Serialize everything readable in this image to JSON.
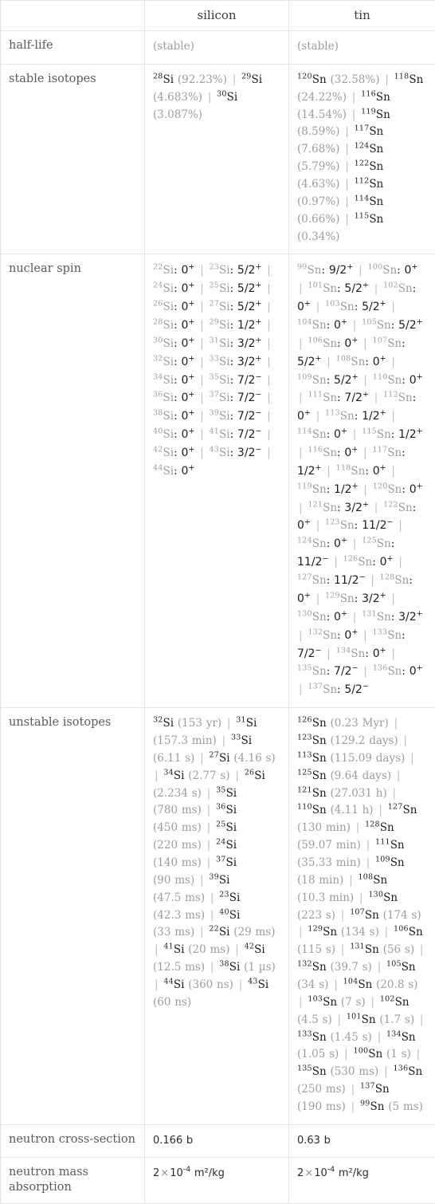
{
  "table": {
    "columns": [
      "",
      "silicon",
      "tin"
    ],
    "rows": [
      {
        "label": "half-life",
        "type": "muted-text",
        "silicon": "(stable)",
        "tin": "(stable)"
      },
      {
        "label": "stable isotopes",
        "type": "isotope-abundance",
        "silicon": [
          {
            "mass": "28",
            "symbol": "Si",
            "value": "(92.23%)"
          },
          {
            "mass": "29",
            "symbol": "Si",
            "value": "(4.683%)"
          },
          {
            "mass": "30",
            "symbol": "Si",
            "value": "(3.087%)"
          }
        ],
        "tin": [
          {
            "mass": "120",
            "symbol": "Sn",
            "value": "(32.58%)"
          },
          {
            "mass": "118",
            "symbol": "Sn",
            "value": "(24.22%)"
          },
          {
            "mass": "116",
            "symbol": "Sn",
            "value": "(14.54%)"
          },
          {
            "mass": "119",
            "symbol": "Sn",
            "value": "(8.59%)"
          },
          {
            "mass": "117",
            "symbol": "Sn",
            "value": "(7.68%)"
          },
          {
            "mass": "124",
            "symbol": "Sn",
            "value": "(5.79%)"
          },
          {
            "mass": "122",
            "symbol": "Sn",
            "value": "(4.63%)"
          },
          {
            "mass": "112",
            "symbol": "Sn",
            "value": "(0.97%)"
          },
          {
            "mass": "114",
            "symbol": "Sn",
            "value": "(0.66%)"
          },
          {
            "mass": "115",
            "symbol": "Sn",
            "value": "(0.34%)"
          }
        ]
      },
      {
        "label": "nuclear spin",
        "type": "nuclear-spin",
        "silicon": [
          {
            "mass": "22",
            "symbol": "Si",
            "spin": "0",
            "sup": "+"
          },
          {
            "mass": "23",
            "symbol": "Si",
            "spin": "5/2",
            "sup": "+"
          },
          {
            "mass": "24",
            "symbol": "Si",
            "spin": "0",
            "sup": "+"
          },
          {
            "mass": "25",
            "symbol": "Si",
            "spin": "5/2",
            "sup": "+"
          },
          {
            "mass": "26",
            "symbol": "Si",
            "spin": "0",
            "sup": "+"
          },
          {
            "mass": "27",
            "symbol": "Si",
            "spin": "5/2",
            "sup": "+"
          },
          {
            "mass": "28",
            "symbol": "Si",
            "spin": "0",
            "sup": "+"
          },
          {
            "mass": "29",
            "symbol": "Si",
            "spin": "1/2",
            "sup": "+"
          },
          {
            "mass": "30",
            "symbol": "Si",
            "spin": "0",
            "sup": "+"
          },
          {
            "mass": "31",
            "symbol": "Si",
            "spin": "3/2",
            "sup": "+"
          },
          {
            "mass": "32",
            "symbol": "Si",
            "spin": "0",
            "sup": "+"
          },
          {
            "mass": "33",
            "symbol": "Si",
            "spin": "3/2",
            "sup": "+"
          },
          {
            "mass": "34",
            "symbol": "Si",
            "spin": "0",
            "sup": "+"
          },
          {
            "mass": "35",
            "symbol": "Si",
            "spin": "7/2",
            "sup": "−"
          },
          {
            "mass": "36",
            "symbol": "Si",
            "spin": "0",
            "sup": "+"
          },
          {
            "mass": "37",
            "symbol": "Si",
            "spin": "7/2",
            "sup": "−"
          },
          {
            "mass": "38",
            "symbol": "Si",
            "spin": "0",
            "sup": "+"
          },
          {
            "mass": "39",
            "symbol": "Si",
            "spin": "7/2",
            "sup": "−"
          },
          {
            "mass": "40",
            "symbol": "Si",
            "spin": "0",
            "sup": "+"
          },
          {
            "mass": "41",
            "symbol": "Si",
            "spin": "7/2",
            "sup": "−"
          },
          {
            "mass": "42",
            "symbol": "Si",
            "spin": "0",
            "sup": "+"
          },
          {
            "mass": "43",
            "symbol": "Si",
            "spin": "3/2",
            "sup": "−"
          },
          {
            "mass": "44",
            "symbol": "Si",
            "spin": "0",
            "sup": "+"
          }
        ],
        "tin": [
          {
            "mass": "99",
            "symbol": "Sn",
            "spin": "9/2",
            "sup": "+"
          },
          {
            "mass": "100",
            "symbol": "Sn",
            "spin": "0",
            "sup": "+"
          },
          {
            "mass": "101",
            "symbol": "Sn",
            "spin": "5/2",
            "sup": "+"
          },
          {
            "mass": "102",
            "symbol": "Sn",
            "spin": "0",
            "sup": "+"
          },
          {
            "mass": "103",
            "symbol": "Sn",
            "spin": "5/2",
            "sup": "+"
          },
          {
            "mass": "104",
            "symbol": "Sn",
            "spin": "0",
            "sup": "+"
          },
          {
            "mass": "105",
            "symbol": "Sn",
            "spin": "5/2",
            "sup": "+"
          },
          {
            "mass": "106",
            "symbol": "Sn",
            "spin": "0",
            "sup": "+"
          },
          {
            "mass": "107",
            "symbol": "Sn",
            "spin": "5/2",
            "sup": "+"
          },
          {
            "mass": "108",
            "symbol": "Sn",
            "spin": "0",
            "sup": "+"
          },
          {
            "mass": "109",
            "symbol": "Sn",
            "spin": "5/2",
            "sup": "+"
          },
          {
            "mass": "110",
            "symbol": "Sn",
            "spin": "0",
            "sup": "+"
          },
          {
            "mass": "111",
            "symbol": "Sn",
            "spin": "7/2",
            "sup": "+"
          },
          {
            "mass": "112",
            "symbol": "Sn",
            "spin": "0",
            "sup": "+"
          },
          {
            "mass": "113",
            "symbol": "Sn",
            "spin": "1/2",
            "sup": "+"
          },
          {
            "mass": "114",
            "symbol": "Sn",
            "spin": "0",
            "sup": "+"
          },
          {
            "mass": "115",
            "symbol": "Sn",
            "spin": "1/2",
            "sup": "+"
          },
          {
            "mass": "116",
            "symbol": "Sn",
            "spin": "0",
            "sup": "+"
          },
          {
            "mass": "117",
            "symbol": "Sn",
            "spin": "1/2",
            "sup": "+"
          },
          {
            "mass": "118",
            "symbol": "Sn",
            "spin": "0",
            "sup": "+"
          },
          {
            "mass": "119",
            "symbol": "Sn",
            "spin": "1/2",
            "sup": "+"
          },
          {
            "mass": "120",
            "symbol": "Sn",
            "spin": "0",
            "sup": "+"
          },
          {
            "mass": "121",
            "symbol": "Sn",
            "spin": "3/2",
            "sup": "+"
          },
          {
            "mass": "122",
            "symbol": "Sn",
            "spin": "0",
            "sup": "+"
          },
          {
            "mass": "123",
            "symbol": "Sn",
            "spin": "11/2",
            "sup": "−"
          },
          {
            "mass": "124",
            "symbol": "Sn",
            "spin": "0",
            "sup": "+"
          },
          {
            "mass": "125",
            "symbol": "Sn",
            "spin": "11/2",
            "sup": "−"
          },
          {
            "mass": "126",
            "symbol": "Sn",
            "spin": "0",
            "sup": "+"
          },
          {
            "mass": "127",
            "symbol": "Sn",
            "spin": "11/2",
            "sup": "−"
          },
          {
            "mass": "128",
            "symbol": "Sn",
            "spin": "0",
            "sup": "+"
          },
          {
            "mass": "129",
            "symbol": "Sn",
            "spin": "3/2",
            "sup": "+"
          },
          {
            "mass": "130",
            "symbol": "Sn",
            "spin": "0",
            "sup": "+"
          },
          {
            "mass": "131",
            "symbol": "Sn",
            "spin": "3/2",
            "sup": "+"
          },
          {
            "mass": "132",
            "symbol": "Sn",
            "spin": "0",
            "sup": "+"
          },
          {
            "mass": "133",
            "symbol": "Sn",
            "spin": "7/2",
            "sup": "−"
          },
          {
            "mass": "134",
            "symbol": "Sn",
            "spin": "0",
            "sup": "+"
          },
          {
            "mass": "135",
            "symbol": "Sn",
            "spin": "7/2",
            "sup": "−"
          },
          {
            "mass": "136",
            "symbol": "Sn",
            "spin": "0",
            "sup": "+"
          },
          {
            "mass": "137",
            "symbol": "Sn",
            "spin": "5/2",
            "sup": "−"
          }
        ]
      },
      {
        "label": "unstable isotopes",
        "type": "isotope-halflife",
        "silicon": [
          {
            "mass": "32",
            "symbol": "Si",
            "value": "(153 yr)"
          },
          {
            "mass": "31",
            "symbol": "Si",
            "value": "(157.3 min)"
          },
          {
            "mass": "33",
            "symbol": "Si",
            "value": "(6.11 s)"
          },
          {
            "mass": "27",
            "symbol": "Si",
            "value": "(4.16 s)"
          },
          {
            "mass": "34",
            "symbol": "Si",
            "value": "(2.77 s)"
          },
          {
            "mass": "26",
            "symbol": "Si",
            "value": "(2.234 s)"
          },
          {
            "mass": "35",
            "symbol": "Si",
            "value": "(780 ms)"
          },
          {
            "mass": "36",
            "symbol": "Si",
            "value": "(450 ms)"
          },
          {
            "mass": "25",
            "symbol": "Si",
            "value": "(220 ms)"
          },
          {
            "mass": "24",
            "symbol": "Si",
            "value": "(140 ms)"
          },
          {
            "mass": "37",
            "symbol": "Si",
            "value": "(90 ms)"
          },
          {
            "mass": "39",
            "symbol": "Si",
            "value": "(47.5 ms)"
          },
          {
            "mass": "23",
            "symbol": "Si",
            "value": "(42.3 ms)"
          },
          {
            "mass": "40",
            "symbol": "Si",
            "value": "(33 ms)"
          },
          {
            "mass": "22",
            "symbol": "Si",
            "value": "(29 ms)"
          },
          {
            "mass": "41",
            "symbol": "Si",
            "value": "(20 ms)"
          },
          {
            "mass": "42",
            "symbol": "Si",
            "value": "(12.5 ms)"
          },
          {
            "mass": "38",
            "symbol": "Si",
            "value": "(1 µs)"
          },
          {
            "mass": "44",
            "symbol": "Si",
            "value": "(360 ns)"
          },
          {
            "mass": "43",
            "symbol": "Si",
            "value": "(60 ns)"
          }
        ],
        "tin": [
          {
            "mass": "126",
            "symbol": "Sn",
            "value": "(0.23 Myr)"
          },
          {
            "mass": "123",
            "symbol": "Sn",
            "value": "(129.2 days)"
          },
          {
            "mass": "113",
            "symbol": "Sn",
            "value": "(115.09 days)"
          },
          {
            "mass": "125",
            "symbol": "Sn",
            "value": "(9.64 days)"
          },
          {
            "mass": "121",
            "symbol": "Sn",
            "value": "(27.031 h)"
          },
          {
            "mass": "110",
            "symbol": "Sn",
            "value": "(4.11 h)"
          },
          {
            "mass": "127",
            "symbol": "Sn",
            "value": "(130 min)"
          },
          {
            "mass": "128",
            "symbol": "Sn",
            "value": "(59.07 min)"
          },
          {
            "mass": "111",
            "symbol": "Sn",
            "value": "(35.33 min)"
          },
          {
            "mass": "109",
            "symbol": "Sn",
            "value": "(18 min)"
          },
          {
            "mass": "108",
            "symbol": "Sn",
            "value": "(10.3 min)"
          },
          {
            "mass": "130",
            "symbol": "Sn",
            "value": "(223 s)"
          },
          {
            "mass": "107",
            "symbol": "Sn",
            "value": "(174 s)"
          },
          {
            "mass": "129",
            "symbol": "Sn",
            "value": "(134 s)"
          },
          {
            "mass": "106",
            "symbol": "Sn",
            "value": "(115 s)"
          },
          {
            "mass": "131",
            "symbol": "Sn",
            "value": "(56 s)"
          },
          {
            "mass": "132",
            "symbol": "Sn",
            "value": "(39.7 s)"
          },
          {
            "mass": "105",
            "symbol": "Sn",
            "value": "(34 s)"
          },
          {
            "mass": "104",
            "symbol": "Sn",
            "value": "(20.8 s)"
          },
          {
            "mass": "103",
            "symbol": "Sn",
            "value": "(7 s)"
          },
          {
            "mass": "102",
            "symbol": "Sn",
            "value": "(4.5 s)"
          },
          {
            "mass": "101",
            "symbol": "Sn",
            "value": "(1.7 s)"
          },
          {
            "mass": "133",
            "symbol": "Sn",
            "value": "(1.45 s)"
          },
          {
            "mass": "134",
            "symbol": "Sn",
            "value": "(1.05 s)"
          },
          {
            "mass": "100",
            "symbol": "Sn",
            "value": "(1 s)"
          },
          {
            "mass": "135",
            "symbol": "Sn",
            "value": "(530 ms)"
          },
          {
            "mass": "136",
            "symbol": "Sn",
            "value": "(250 ms)"
          },
          {
            "mass": "137",
            "symbol": "Sn",
            "value": "(190 ms)"
          },
          {
            "mass": "99",
            "symbol": "Sn",
            "value": "(5 ms)"
          }
        ]
      },
      {
        "label": "neutron cross-section",
        "type": "plain",
        "silicon": "0.166 b",
        "tin": "0.63 b"
      },
      {
        "label": "neutron mass absorption",
        "type": "scientific",
        "silicon": {
          "mantissa": "2",
          "times": "×",
          "base": "10",
          "exponent": "-4",
          "unit": "m²/kg"
        },
        "tin": {
          "mantissa": "2",
          "times": "×",
          "base": "10",
          "exponent": "-4",
          "unit": "m²/kg"
        }
      }
    ],
    "separator": "|",
    "colors": {
      "border": "#e3e3e3",
      "label_text": "#5a5a5a",
      "value_text": "#2b2b2b",
      "muted_text": "#9c9c9c",
      "separator": "#b9b9b9",
      "background": "#ffffff"
    }
  }
}
